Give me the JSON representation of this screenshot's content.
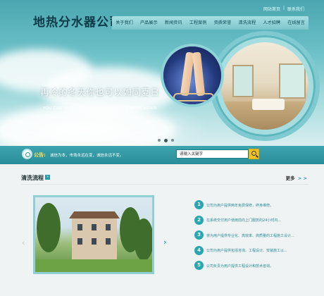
{
  "header": {
    "logo": "地热分水器公司",
    "top_links": [
      "网站首页",
      "|",
      "联系我们"
    ],
    "nav": [
      "关于我们",
      "产品展示",
      "新闻资讯",
      "工程案例",
      "资质荣誉",
      "清洗流程",
      "人才招聘",
      "在线留言"
    ]
  },
  "hero": {
    "slogan_cn": "再冷的冬天你也可以如同夏日",
    "slogan_en": "YOU CAN ALSO LIKE A SUMMER COLD WINTER AGAIN",
    "slide_count": 3,
    "active_slide": 2
  },
  "notice": {
    "label": "公告:",
    "text": "诚信为本，市场永远在变，诚信永远不变。"
  },
  "search": {
    "placeholder": "请输入关键字"
  },
  "section": {
    "title": "清洗流程",
    "title_arrow": "»",
    "more": "更多",
    "more_chevron": "> >",
    "prev_arrow": "‹",
    "next_arrow": "›",
    "steps": [
      {
        "num": "1",
        "text": "公司为用户提供两年免费保修，终身维修。"
      },
      {
        "num": "2",
        "text": "在系统交付用户使用前向上门服务的24小时内..."
      },
      {
        "num": "3",
        "text": "将为用户提供专业化、高效率、高质量的工程施工设计..."
      },
      {
        "num": "4",
        "text": "公司为用户提供包括咨询、工程设计、安装施工以..."
      },
      {
        "num": "5",
        "text": "公司负责为用户提供工程设计和技术咨询。"
      }
    ]
  },
  "colors": {
    "brand_teal": "#2ba6b0",
    "notice_bar": "#2a8e99",
    "notice_label": "#ffe45c",
    "search_button": "#f2c320"
  }
}
